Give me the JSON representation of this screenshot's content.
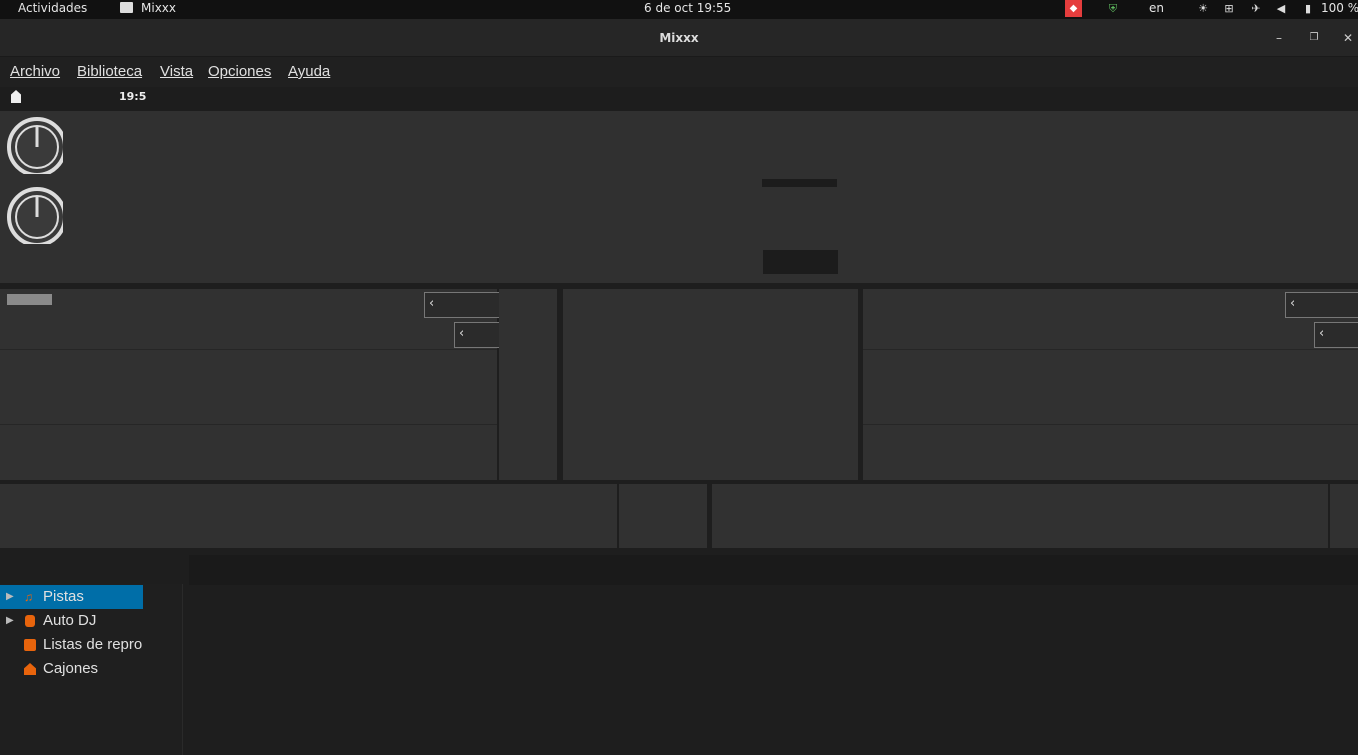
{
  "topbar": {
    "activities": "Actividades",
    "app_name": "Mixxx",
    "datetime": "6 de oct  19:55",
    "keyboard": "en",
    "battery": "100 %"
  },
  "window": {
    "title": "Mixxx"
  },
  "menu": [
    "Archivo",
    "Biblioteca",
    "Vista",
    "Opciones",
    "Ayuda"
  ],
  "status": {
    "clock": "19:5"
  },
  "library": {
    "items": [
      {
        "label": "Pistas",
        "icon": "music-note-icon",
        "expand": true,
        "selected": true
      },
      {
        "label": "Auto DJ",
        "icon": "robot-icon",
        "expand": true,
        "selected": false
      },
      {
        "label": "Listas de repro",
        "icon": "playlist-icon",
        "expand": false,
        "selected": false
      },
      {
        "label": "Cajones",
        "icon": "crate-icon",
        "expand": false,
        "selected": false
      }
    ]
  },
  "colors": {
    "accent": "#006ea8",
    "icon_orange": "#e8640c",
    "ubuntu_red": "#e53d3d"
  }
}
